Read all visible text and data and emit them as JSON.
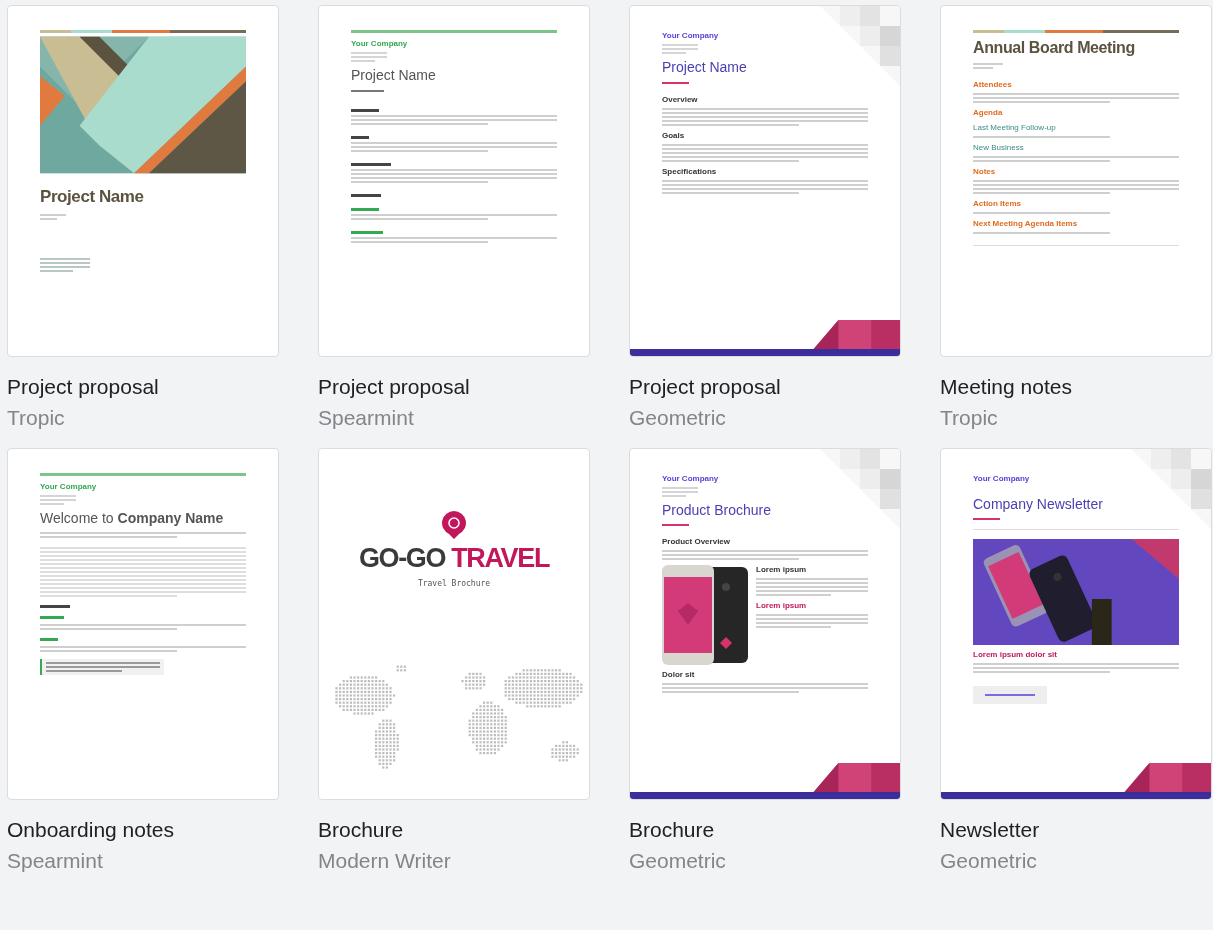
{
  "templates": [
    {
      "title": "Project proposal",
      "subtitle": "Tropic",
      "preview": {
        "kind": "tropic",
        "title": "Project Name"
      }
    },
    {
      "title": "Project proposal",
      "subtitle": "Spearmint",
      "preview": {
        "kind": "spearmint",
        "company": "Your Company",
        "title": "Project Name"
      }
    },
    {
      "title": "Project proposal",
      "subtitle": "Geometric",
      "preview": {
        "kind": "geometric",
        "company": "Your Company",
        "title": "Project Name",
        "sections": [
          {
            "kind": "heading",
            "text": "Overview"
          },
          {
            "kind": "heading",
            "text": "Goals"
          },
          {
            "kind": "heading",
            "text": "Specifications"
          }
        ]
      }
    },
    {
      "title": "Meeting notes",
      "subtitle": "Tropic",
      "preview": {
        "kind": "tropic_notes",
        "title": "Annual Board Meeting",
        "sections": [
          {
            "kind": "heading",
            "text": "Attendees"
          },
          {
            "kind": "heading",
            "text": "Agenda"
          },
          {
            "kind": "subheading",
            "text": "Last Meeting Follow-up"
          },
          {
            "kind": "subheading",
            "text": "New Business"
          },
          {
            "kind": "heading",
            "text": "Notes"
          },
          {
            "kind": "heading",
            "text": "Action Items"
          },
          {
            "kind": "heading",
            "text": "Next Meeting Agenda Items"
          }
        ]
      }
    },
    {
      "title": "Onboarding notes",
      "subtitle": "Spearmint",
      "preview": {
        "kind": "onboarding",
        "company": "Your Company",
        "title": "Welcome to **Company Name**"
      }
    },
    {
      "title": "Brochure",
      "subtitle": "Modern Writer",
      "preview": {
        "kind": "travel",
        "brand_dark": "GO-GO",
        "brand_accent": "TRAVEL",
        "tagline": "Travel Brochure"
      }
    },
    {
      "title": "Brochure",
      "subtitle": "Geometric",
      "preview": {
        "kind": "geometric_brochure",
        "company": "Your Company",
        "title": "Product Brochure",
        "sections": [
          {
            "kind": "heading",
            "text": "Product Overview"
          },
          {
            "kind": "heading",
            "text": "Lorem ipsum"
          },
          {
            "kind": "accent",
            "text": "Lorem ipsum"
          },
          {
            "kind": "heading",
            "text": "Dolor sit"
          }
        ]
      }
    },
    {
      "title": "Newsletter",
      "subtitle": "Geometric",
      "preview": {
        "kind": "newsletter",
        "company": "Your Company",
        "title": "Company Newsletter",
        "sections": [
          {
            "kind": "accent",
            "text": "Lorem ipsum dolor sit"
          }
        ]
      }
    }
  ]
}
